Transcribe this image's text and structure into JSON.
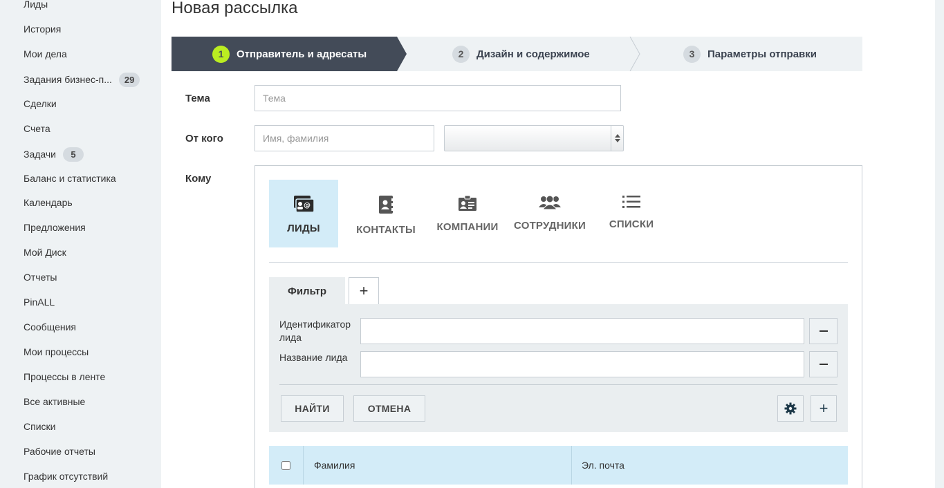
{
  "sidebar": {
    "items": [
      {
        "label": "Лиды"
      },
      {
        "label": "История"
      },
      {
        "label": "Мои дела"
      },
      {
        "label": "Задания бизнес-п...",
        "count": "29"
      },
      {
        "label": "Сделки"
      },
      {
        "label": "Счета"
      },
      {
        "label": "Задачи",
        "count": "5"
      },
      {
        "label": "Баланс и статистика"
      },
      {
        "label": "Календарь"
      },
      {
        "label": "Предложения"
      },
      {
        "label": "Мой Диск"
      },
      {
        "label": "Отчеты"
      },
      {
        "label": "PinALL"
      },
      {
        "label": "Сообщения"
      },
      {
        "label": "Мои процессы"
      },
      {
        "label": "Процессы в ленте"
      },
      {
        "label": "Все активные"
      },
      {
        "label": "Списки"
      },
      {
        "label": "Рабочие отчеты"
      },
      {
        "label": "График отсутствий"
      }
    ]
  },
  "page": {
    "title": "Новая рассылка"
  },
  "stepper": {
    "steps": [
      {
        "num": "1",
        "label": "Отправитель и адресаты",
        "active": true
      },
      {
        "num": "2",
        "label": "Дизайн и содержимое",
        "active": false
      },
      {
        "num": "3",
        "label": "Параметры отправки",
        "active": false
      }
    ]
  },
  "form": {
    "subject_label": "Тема",
    "subject_placeholder": "Тема",
    "from_label": "От кого",
    "from_name_placeholder": "Имя, фамилия",
    "from_email_value": "",
    "to_label": "Кому"
  },
  "recipients": {
    "tabs": [
      {
        "label": "ЛИДЫ",
        "icon": "lead-card-icon",
        "active": true
      },
      {
        "label": "КОНТАКТЫ",
        "icon": "address-book-icon",
        "active": false
      },
      {
        "label": "КОМПАНИИ",
        "icon": "company-card-icon",
        "active": false
      },
      {
        "label": "СОТРУДНИКИ",
        "icon": "employees-icon",
        "active": false
      },
      {
        "label": "СПИСКИ",
        "icon": "list-icon",
        "active": false
      }
    ],
    "filter_tab_label": "Фильтр",
    "filter_add_label": "+",
    "filter_fields": [
      {
        "label": "Идентификатор лида",
        "value": ""
      },
      {
        "label": "Название лида",
        "value": ""
      }
    ],
    "find_button": "НАЙТИ",
    "cancel_button": "ОТМЕНА",
    "settings_icon": "gear-icon",
    "add_field_label": "+",
    "table": {
      "columns": [
        "Фамилия",
        "Эл. почта"
      ]
    }
  },
  "colors": {
    "step_active_bg": "#434b58",
    "step_active_num": "#bbed21",
    "tab_active_bg": "#d3ecf8",
    "sidebar_bg": "#eef2f4"
  }
}
